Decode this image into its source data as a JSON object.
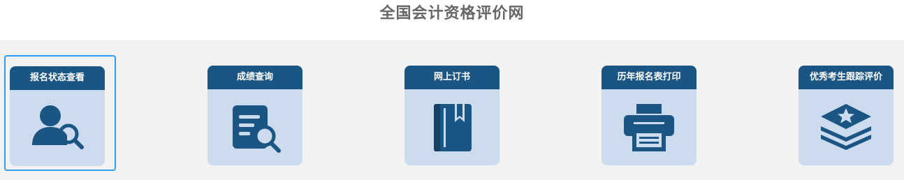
{
  "header": {
    "title": "全国会计资格评价网"
  },
  "services": [
    {
      "label": "报名状态查看",
      "icon": "user-search-icon"
    },
    {
      "label": "成绩查询",
      "icon": "document-search-icon"
    },
    {
      "label": "网上订书",
      "icon": "book-icon"
    },
    {
      "label": "历年报名表打印",
      "icon": "printer-icon"
    },
    {
      "label": "优秀考生跟踪评价",
      "icon": "layers-star-icon"
    }
  ],
  "colors": {
    "tile_header": "#1b5584",
    "tile_body": "#ccdcee",
    "selected_border": "#2f9cf0",
    "icon": "#1b5584"
  }
}
